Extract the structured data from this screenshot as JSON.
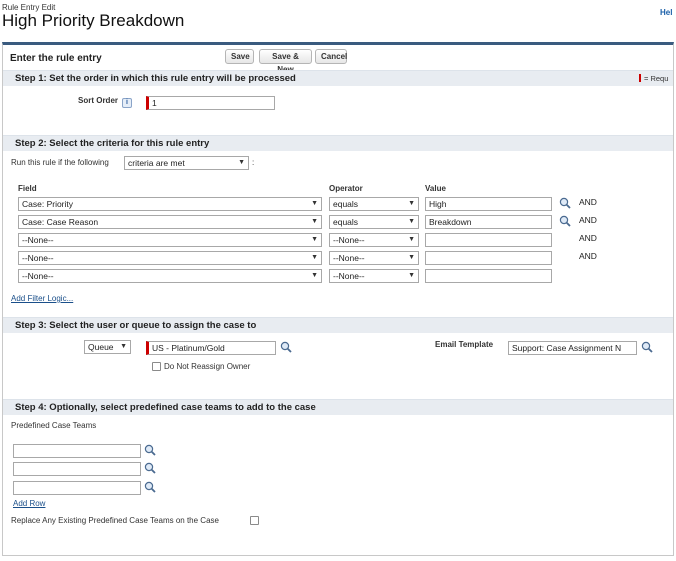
{
  "header": {
    "breadcrumb": "Rule Entry Edit",
    "title": "High Priority Breakdown",
    "help": "Hel"
  },
  "panel": {
    "title": "Enter the rule entry",
    "buttons": {
      "save": "Save",
      "save_new": "Save & New",
      "cancel": "Cancel"
    },
    "required_legend": "= Requ"
  },
  "step1": {
    "title": "Step 1: Set the order in which this rule entry will be processed",
    "sort_order_label": "Sort Order",
    "info_icon": "i",
    "sort_order_value": "1"
  },
  "step2": {
    "title": "Step 2: Select the criteria for this rule entry",
    "run_label": "Run this rule if the following",
    "criteria_select": "criteria are met",
    "colon": ":",
    "columns": {
      "field": "Field",
      "operator": "Operator",
      "value": "Value"
    },
    "rows": [
      {
        "field": "Case: Priority",
        "operator": "equals",
        "value": "High",
        "and": "AND"
      },
      {
        "field": "Case: Case Reason",
        "operator": "equals",
        "value": "Breakdown",
        "and": "AND"
      },
      {
        "field": "--None--",
        "operator": "--None--",
        "value": "",
        "and": "AND"
      },
      {
        "field": "--None--",
        "operator": "--None--",
        "value": "",
        "and": "AND"
      },
      {
        "field": "--None--",
        "operator": "--None--",
        "value": "",
        "and": ""
      }
    ],
    "add_filter_logic": "Add Filter Logic..."
  },
  "step3": {
    "title": "Step 3: Select the user or queue to assign the case to",
    "assignee_type": "Queue",
    "assignee_value": "US - Platinum/Gold",
    "do_not_reassign_label": "Do Not Reassign Owner",
    "email_template_label": "Email Template",
    "email_template_value": "Support: Case Assignment N"
  },
  "step4": {
    "title": "Step 4: Optionally, select predefined case teams to add to the case",
    "teams_label": "Predefined Case Teams",
    "team_inputs": [
      "",
      "",
      ""
    ],
    "add_row": "Add Row",
    "replace_label": "Replace Any Existing Predefined Case Teams on the Case"
  },
  "colors": {
    "header_border": "#3a5b7f",
    "section_bg": "#e8ecf1",
    "required": "#cc0000",
    "link": "#1a4f8a"
  },
  "icons": {
    "lookup": "magnifier-icon",
    "info": "info-icon",
    "dropdown": "chevron-down-icon"
  }
}
